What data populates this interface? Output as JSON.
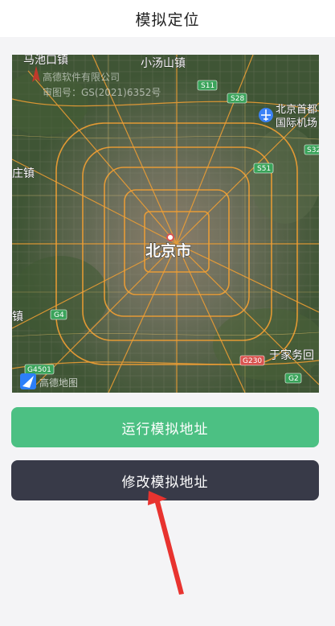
{
  "header": {
    "title": "模拟定位"
  },
  "map": {
    "labels": {
      "majiakou": "马池口镇",
      "xiaotangshan": "小汤山镇",
      "airport_line1": "北京首都",
      "airport_line2": "国际机场",
      "zhuang": "庄镇",
      "beijing": "北京市",
      "yujiawu": "于家务回",
      "zhen": "镇"
    },
    "road_badges": {
      "s11": "S11",
      "s28": "S28",
      "s32": "S32",
      "s51": "S51",
      "g4": "G4",
      "g4501": "G4501",
      "g230": "G230",
      "g2": "G2"
    },
    "copyright_line1": "高德软件有限公司",
    "copyright_line2": "审图号：GS(2021)6352号",
    "brand": "高德地图",
    "colors": {
      "road": "#f3a033",
      "badge_green": "#3aa35a",
      "badge_red": "#d9534f"
    }
  },
  "buttons": {
    "run": "运行模拟地址",
    "edit": "修改模拟地址"
  },
  "colors": {
    "run_button": "#4cc083",
    "edit_button": "#383a48",
    "annotation_arrow": "#e8332f"
  }
}
